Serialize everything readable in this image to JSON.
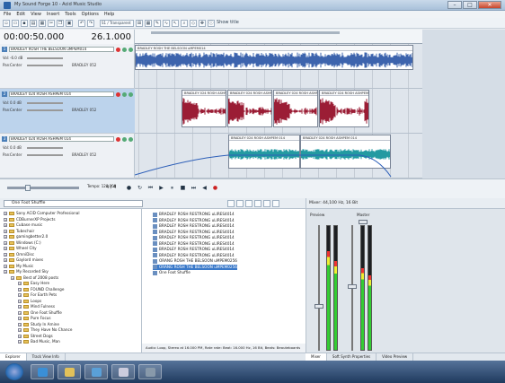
{
  "window": {
    "title": "My Sound Forge 10 - Acid Music Studio"
  },
  "menu": [
    "File",
    "Edit",
    "View",
    "Insert",
    "Tools",
    "Options",
    "Help"
  ],
  "toolbar": {
    "show_title": "Show title",
    "field_label": "S1 / Transparent"
  },
  "transport": {
    "position": "00:00:50.000",
    "beat": "26.1.000",
    "rate_label": "Tempo: 120.000",
    "rate_value": "4 / 4"
  },
  "tracks": [
    {
      "name": "BRADLEY ROSH THE BELSOON uMPEM014",
      "vol_label": "Vol:",
      "vol": "-6.0 dB",
      "pan_label": "Pan:",
      "pan": "Center",
      "fx": "BRADLEY 052",
      "color": "#4a6fb3"
    },
    {
      "name": "BRADLEY 024 ROSH ASHPEM 014",
      "vol_label": "Vol:",
      "vol": "0.0 dB",
      "pan_label": "Pan:",
      "pan": "Center",
      "fx": "BRADLEY 052",
      "color": "#9a1c33"
    },
    {
      "name": "BRADLEY 024 ROSH ASHPEM 014",
      "vol_label": "Vol:",
      "vol": "0.0 dB",
      "pan_label": "Pan:",
      "pan": "Center",
      "fx": "BRADLEY 052",
      "color": "#2aa0a6"
    }
  ],
  "clips": [
    {
      "lane": 0,
      "title": "BRADLEY ROSH THE BELSOON uMPEM014",
      "color": "#3d64ad"
    },
    {
      "lane": 1,
      "title": "BRADLEY 024 ROSH ASHPEM 014",
      "color": "#9b1d35"
    },
    {
      "lane": 1,
      "title": "BRADLEY 024 ROSH ASHPEM 014",
      "color": "#9b1d35"
    },
    {
      "lane": 1,
      "title": "BRADLEY 024 ROSH ASHPEM 014",
      "color": "#9b1d35"
    },
    {
      "lane": 1,
      "title": "BRADLEY 024 ROSH ASHPEM 014",
      "color": "#9b1d35"
    },
    {
      "lane": 2,
      "title": "BRADLEY 024 ROSH ASHPEM 014",
      "color": "#239aa1"
    },
    {
      "lane": 2,
      "title": "BRADLEY 024 ROSH ASHPEM 014",
      "color": "#239aa1"
    }
  ],
  "explorer": {
    "path": "One Foot Shuffle",
    "tree": [
      "Sony ACID Computer Professional",
      "CDBurnerXP Projects",
      "Cubase music",
      "Tubechair",
      "gamingbetter2.0",
      "Windows (C:)",
      "Wheel City",
      "OmniDisc",
      "Gaylord mixes",
      "My Music",
      "My Recorded Sky",
      "Best of 2008 posts",
      "Easy Here",
      "FOUND Challenge",
      "For Earth Pets",
      "Loops",
      "Mind Fulness",
      "One Foot Shuffle",
      "Pure Focus",
      "Study In Amine",
      "They Have No Chance",
      "Street Dogs",
      "Bad Music, Man"
    ],
    "files": [
      "BRADLEY ROSH RESTRONG uLIRES4014",
      "BRADLEY ROSH RESTRONG uLIRES4014",
      "BRADLEY ROSH RESTRONG uLIRES4014",
      "BRADLEY ROSH RESTRONG uLIRES4014",
      "BRADLEY ROSH RESTRONG uLIRES4014",
      "BRADLEY ROSH RESTRONG uLIRES4014",
      "BRADLEY ROSH RESTRONG uLIRES4014",
      "BRADLEY ROSH RESTRONG uLIRES4014",
      "ORANG ROSH THE BELSOON uMPEM0256",
      "ORANG ROSH THE BELSOON uMPEM0256",
      "One Foot Shuffle"
    ],
    "status": "Audio: Loop, Stereo at 16.000 PM, Rate rate: Beat: 16.000 Hz, 16 Bit, Beats: Beauteboards"
  },
  "explorer_tabs": [
    "Explorer",
    "Track View Info"
  ],
  "mixer": {
    "title": "Mixer: 44,100 Hz, 16 Bit",
    "preview_label": "Preview",
    "master_label": "Master",
    "meter_levels": [
      0.8,
      0.72,
      0.66,
      0.6
    ],
    "tabs": [
      "Mixer",
      "Soft Synth Properties",
      "Video Preview"
    ]
  }
}
